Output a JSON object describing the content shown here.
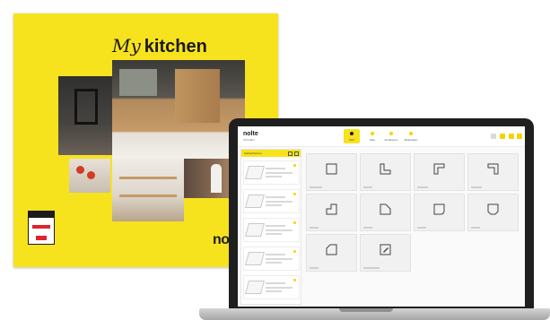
{
  "brochure": {
    "title_my": "My",
    "title_kitchen": "kitchen",
    "logo": "nol"
  },
  "app": {
    "logo": "nolte",
    "logo_sub": "KÜCHEN",
    "nav": [
      {
        "label": "Start",
        "active": true
      },
      {
        "label": "Stile",
        "active": false
      },
      {
        "label": "Funktionen",
        "active": false
      },
      {
        "label": "Materialien",
        "active": false
      }
    ],
    "sidebar": {
      "header": "Küchenformen",
      "items": [
        {
          "name": "Planung 1"
        },
        {
          "name": "Planung 2"
        },
        {
          "name": "Planung 3"
        },
        {
          "name": "Planung 4"
        },
        {
          "name": "Planung 5"
        }
      ]
    },
    "tiles": [
      {
        "shape": "square"
      },
      {
        "shape": "l-left"
      },
      {
        "shape": "l-right"
      },
      {
        "shape": "corner-right"
      },
      {
        "shape": "u-notch"
      },
      {
        "shape": "cut-corner"
      },
      {
        "shape": "rounded-bottom"
      },
      {
        "shape": "trapezoid"
      },
      {
        "shape": "beveled"
      },
      {
        "shape": "edit-pencil"
      }
    ]
  }
}
